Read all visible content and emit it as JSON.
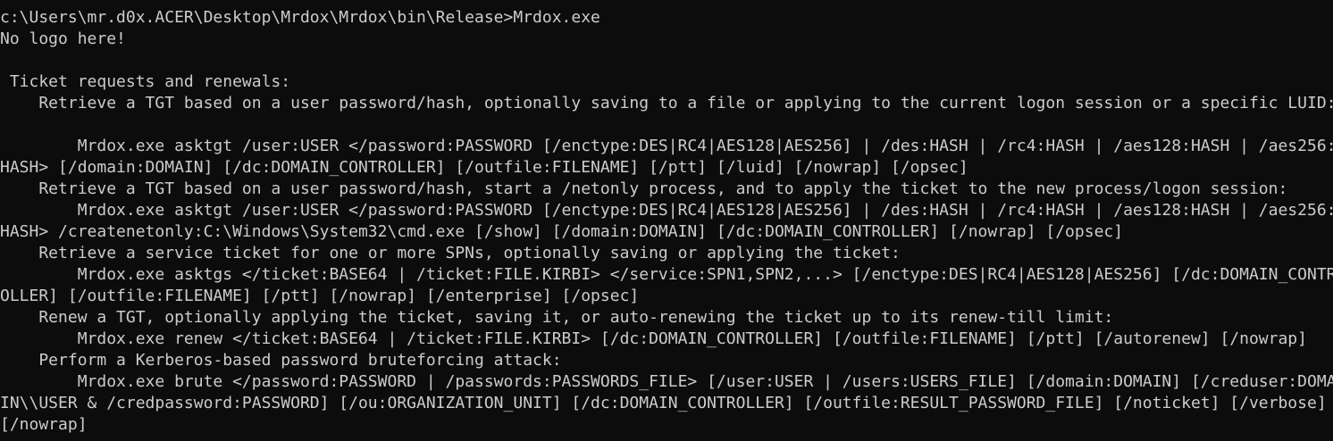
{
  "terminal": {
    "lines": [
      "c:\\Users\\mr.d0x.ACER\\Desktop\\Mrdox\\Mrdox\\bin\\Release>Mrdox.exe",
      "No logo here!",
      "",
      " Ticket requests and renewals:",
      "    Retrieve a TGT based on a user password/hash, optionally saving to a file or applying to the current logon session or a specific LUID:",
      "",
      "        Mrdox.exe asktgt /user:USER </password:PASSWORD [/enctype:DES|RC4|AES128|AES256] | /des:HASH | /rc4:HASH | /aes128:HASH | /aes256:",
      "HASH> [/domain:DOMAIN] [/dc:DOMAIN_CONTROLLER] [/outfile:FILENAME] [/ptt] [/luid] [/nowrap] [/opsec]",
      "    Retrieve a TGT based on a user password/hash, start a /netonly process, and to apply the ticket to the new process/logon session:",
      "        Mrdox.exe asktgt /user:USER </password:PASSWORD [/enctype:DES|RC4|AES128|AES256] | /des:HASH | /rc4:HASH | /aes128:HASH | /aes256:",
      "HASH> /createnetonly:C:\\Windows\\System32\\cmd.exe [/show] [/domain:DOMAIN] [/dc:DOMAIN_CONTROLLER] [/nowrap] [/opsec]",
      "    Retrieve a service ticket for one or more SPNs, optionally saving or applying the ticket:",
      "        Mrdox.exe asktgs </ticket:BASE64 | /ticket:FILE.KIRBI> </service:SPN1,SPN2,...> [/enctype:DES|RC4|AES128|AES256] [/dc:DOMAIN_CONTR",
      "OLLER] [/outfile:FILENAME] [/ptt] [/nowrap] [/enterprise] [/opsec]",
      "    Renew a TGT, optionally applying the ticket, saving it, or auto-renewing the ticket up to its renew-till limit:",
      "        Mrdox.exe renew </ticket:BASE64 | /ticket:FILE.KIRBI> [/dc:DOMAIN_CONTROLLER] [/outfile:FILENAME] [/ptt] [/autorenew] [/nowrap]",
      "    Perform a Kerberos-based password bruteforcing attack:",
      "        Mrdox.exe brute </password:PASSWORD | /passwords:PASSWORDS_FILE> [/user:USER | /users:USERS_FILE] [/domain:DOMAIN] [/creduser:DOMA",
      "IN\\\\USER & /credpassword:PASSWORD] [/ou:ORGANIZATION_UNIT] [/dc:DOMAIN_CONTROLLER] [/outfile:RESULT_PASSWORD_FILE] [/noticket] [/verbose]",
      "[/nowrap]"
    ]
  }
}
